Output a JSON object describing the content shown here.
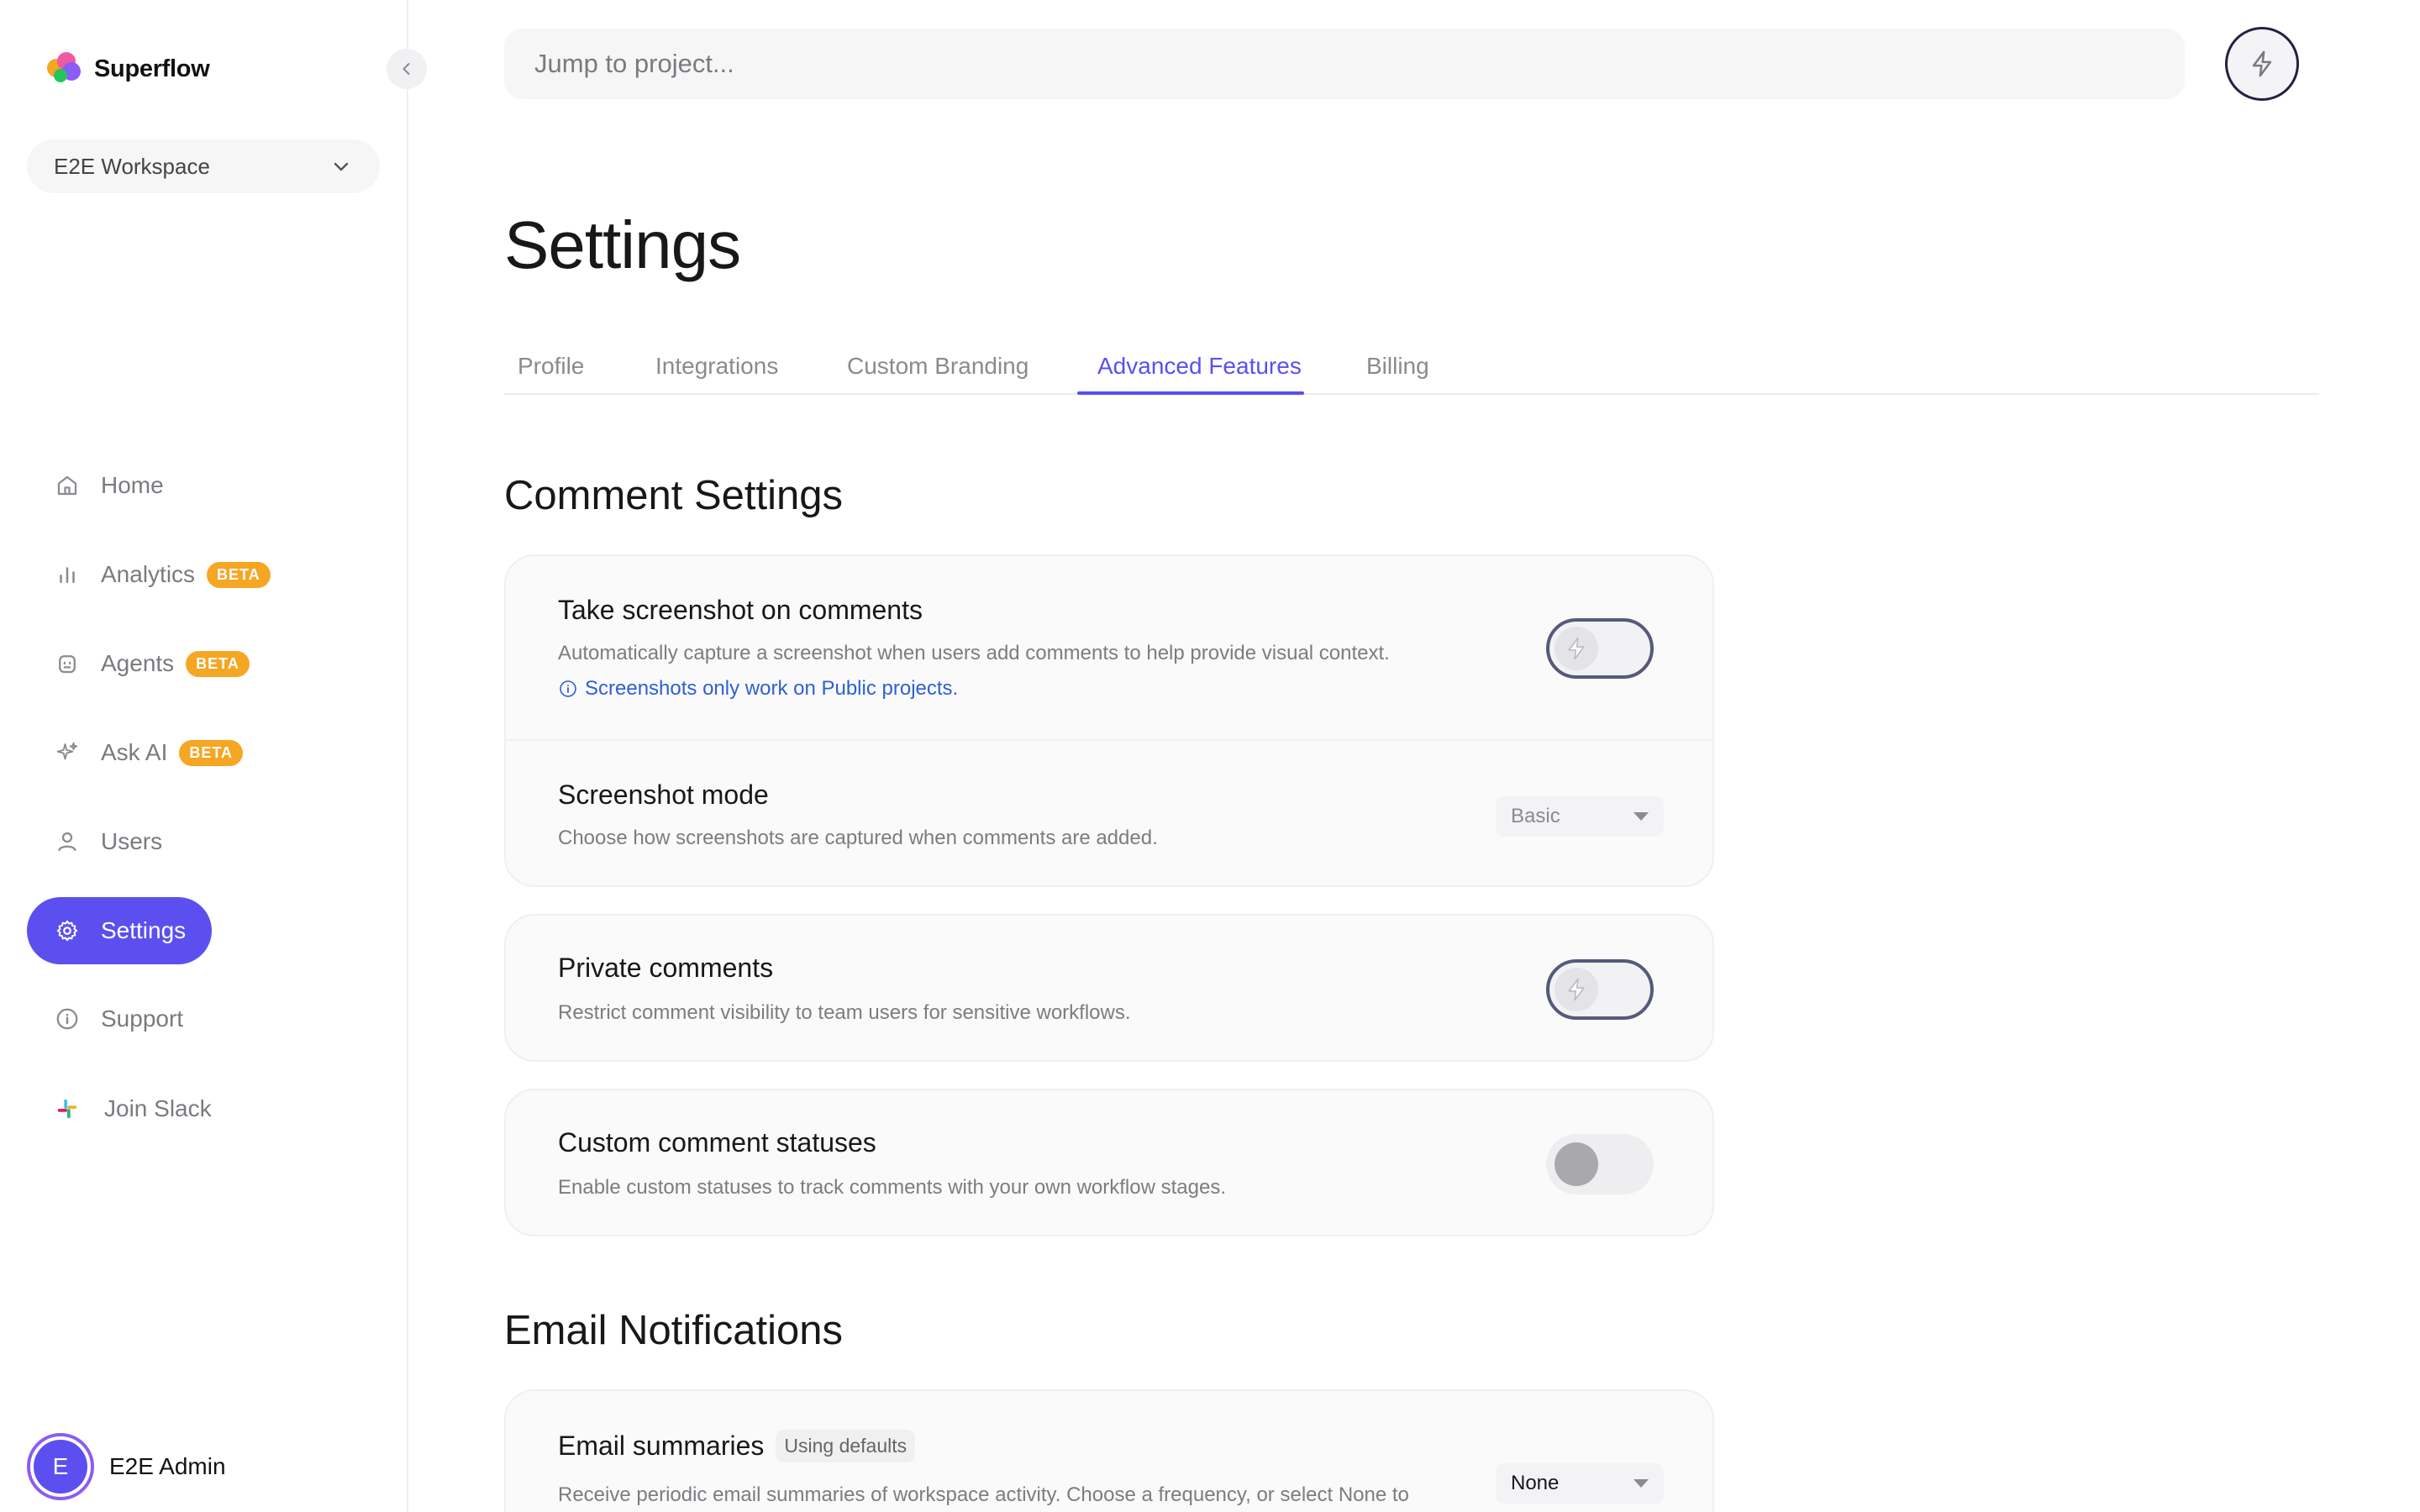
{
  "brand": {
    "name": "Superflow"
  },
  "workspace": {
    "label": "E2E Workspace"
  },
  "nav": {
    "items": [
      {
        "label": "Home",
        "icon": "home-icon"
      },
      {
        "label": "Analytics",
        "icon": "bar-chart-icon",
        "badge": "BETA"
      },
      {
        "label": "Agents",
        "icon": "robot-icon",
        "badge": "BETA"
      },
      {
        "label": "Ask AI",
        "icon": "sparkles-icon",
        "badge": "BETA"
      },
      {
        "label": "Users",
        "icon": "user-icon"
      },
      {
        "label": "Settings",
        "icon": "gear-icon",
        "active": true
      },
      {
        "label": "Support",
        "icon": "info-icon"
      },
      {
        "label": "Join Slack",
        "icon": "slack-icon"
      }
    ]
  },
  "user": {
    "initial": "E",
    "name": "E2E Admin"
  },
  "search": {
    "placeholder": "Jump to project..."
  },
  "page": {
    "title": "Settings"
  },
  "tabs": [
    {
      "label": "Profile"
    },
    {
      "label": "Integrations"
    },
    {
      "label": "Custom Branding"
    },
    {
      "label": "Advanced Features",
      "active": true
    },
    {
      "label": "Billing"
    }
  ],
  "comment_settings": {
    "title": "Comment Settings",
    "screenshot": {
      "title": "Take screenshot on comments",
      "description": "Automatically capture a screenshot when users add comments to help provide visual context.",
      "note": "Screenshots only work on Public projects.",
      "enabled": false
    },
    "screenshot_mode": {
      "title": "Screenshot mode",
      "description": "Choose how screenshots are captured when comments are added.",
      "value": "Basic"
    },
    "private_comments": {
      "title": "Private comments",
      "description": "Restrict comment visibility to team users for sensitive workflows.",
      "enabled": false
    },
    "custom_statuses": {
      "title": "Custom comment statuses",
      "description": "Enable custom statuses to track comments with your own workflow stages.",
      "enabled": false
    }
  },
  "email_notifications": {
    "title": "Email Notifications",
    "summaries": {
      "title": "Email summaries",
      "badge": "Using defaults",
      "description": "Receive periodic email summaries of workspace activity. Choose a frequency, or select None to",
      "value": "None"
    }
  },
  "colors": {
    "accent": "#5b4ff0",
    "beta": "#f5a623",
    "link": "#2f5fd6"
  }
}
